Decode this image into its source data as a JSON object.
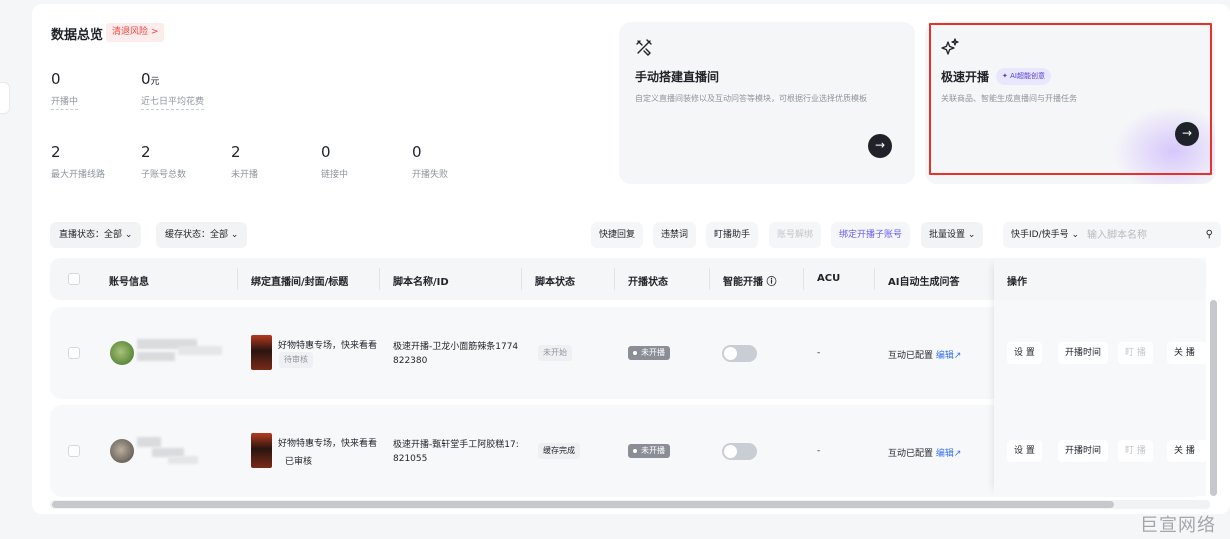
{
  "overview": {
    "title": "数据总览",
    "risk_tag": "清退风险 >",
    "stats_row1": [
      {
        "value": "0",
        "unit": "",
        "label": "开播中"
      },
      {
        "value": "0",
        "unit": "元",
        "label": "近七日平均花费"
      }
    ],
    "stats_row2": [
      {
        "value": "2",
        "label": "最大开播线路"
      },
      {
        "value": "2",
        "label": "子账号总数"
      },
      {
        "value": "2",
        "label": "未开播"
      },
      {
        "value": "0",
        "label": "链接中"
      },
      {
        "value": "0",
        "label": "开播失败"
      }
    ]
  },
  "cards": {
    "manual": {
      "icon": "tools-icon",
      "title": "手动搭建直播间",
      "desc": "自定义直播间装修以及互动问答等模块，可根据行业选择优质模板",
      "arrow": "→"
    },
    "quick": {
      "icon": "sparkle-icon",
      "title": "极速开播",
      "badge": "✦ AI超能创意",
      "desc": "关联商品、智能生成直播间与开播任务",
      "arrow": "→"
    }
  },
  "filters": {
    "live_status": "直播状态：全部 ⌄",
    "cache_status": "缓存状态：全部 ⌄"
  },
  "toolbar": {
    "quick_reply": "快捷回复",
    "banned_words": "违禁词",
    "live_assistant": "盯播助手",
    "unbind": "账号解绑",
    "bind_sub": "绑定开播子账号",
    "batch": "批量设置 ⌄",
    "search_type": "快手ID/快手号 ⌄",
    "search_placeholder": "输入脚本名称",
    "search_icon": "⚲"
  },
  "table": {
    "headers": [
      "账号信息",
      "绑定直播间/封面/标题",
      "脚本名称/ID",
      "脚本状态",
      "开播状态",
      "智能开播 ⓘ",
      "ACU",
      "AI自动生成问答",
      "操作"
    ],
    "rows": [
      {
        "title": "好物特惠专场，快来看看",
        "review": "待审核",
        "script_name": "极速开播-卫龙小面筋辣条1774",
        "script_id": "822380",
        "script_status": "未开始",
        "live_status": "未开播",
        "smart_live": false,
        "acu": "-",
        "ai_qa": "互动已配置",
        "ai_edit": "编辑↗",
        "ops": [
          "设 置",
          "开播时间",
          "盯 播",
          "关 播"
        ]
      },
      {
        "title": "好物特惠专场，快来看看",
        "review": "已审核",
        "script_name": "极速开播-甄轩堂手工阿胶糕17:",
        "script_id": "821055",
        "script_status": "缓存完成",
        "live_status": "未开播",
        "smart_live": false,
        "acu": "-",
        "ai_qa": "互动已配置",
        "ai_edit": "编辑↗",
        "ops": [
          "设 置",
          "开播时间",
          "盯 播",
          "关 播"
        ]
      }
    ]
  },
  "watermark": "巨宣网络",
  "colors": {
    "accent_red": "#e8312a",
    "link_blue": "#3470f0",
    "ai_purple": "#6a5cf0"
  }
}
